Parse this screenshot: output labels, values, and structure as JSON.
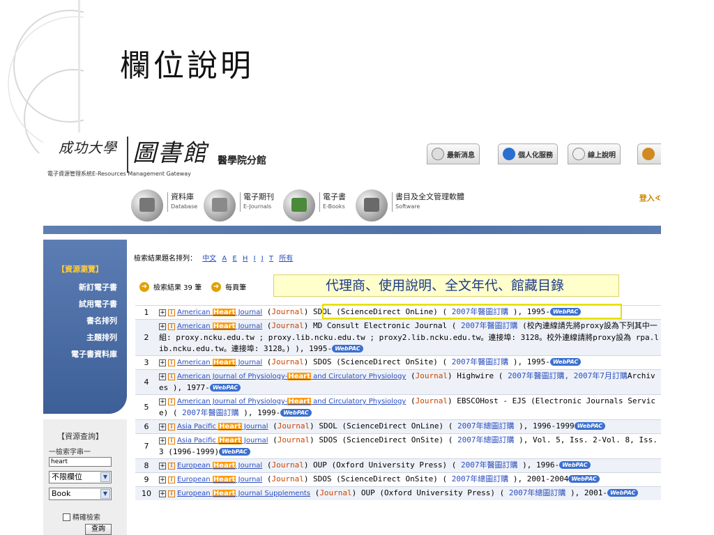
{
  "slide": {
    "title": "欄位說明",
    "callout": "代理商、使用說明、全文年代、館藏目錄"
  },
  "header": {
    "logo_university": "成功大學",
    "logo_subtitle": "電子資源管理系統E-Resources Management Gateway",
    "logo_library": "圖書館",
    "logo_branch": "醫學院分館",
    "logo_english": "E-Resources Management Gateway",
    "top_buttons": [
      "最新消息",
      "個人化服務",
      "線上說明"
    ],
    "categories": [
      {
        "label": "資料庫",
        "sub": "Database"
      },
      {
        "label": "電子期刊",
        "sub": "E-Journals"
      },
      {
        "label": "電子書",
        "sub": "E-Books"
      },
      {
        "label": "書目及全文管理軟體",
        "sub": "Software"
      }
    ],
    "login": "登入∢"
  },
  "sidebar": {
    "header": "【資源瀏覽】",
    "items": [
      "新訂電子書",
      "試用電子書",
      "書名排列",
      "主題排列",
      "電子書資料庫"
    ]
  },
  "search": {
    "title": "【資源查詢】",
    "subtitle": "一檢索字串一",
    "query": "heart",
    "field": "不限欄位",
    "type": "Book",
    "exact_label": "精確檢索",
    "button": "查詢"
  },
  "main": {
    "sort_label": "檢索結果題名排列：",
    "sort_links": [
      "中文",
      "A",
      "E",
      "H",
      "I",
      "J",
      "T",
      "所有"
    ],
    "results_count": "檢索結果 39 筆",
    "per_page": "每頁筆"
  },
  "results": [
    {
      "num": "1",
      "pre": "American ",
      "hl": "Heart",
      "post": " Journal",
      "tail": " SDOL (ScienceDirect OnLine) ( ",
      "order": "2007年醫圖訂購",
      "end": " ), 1995-"
    },
    {
      "num": "2",
      "pre": "American ",
      "hl": "Heart",
      "post": " Journal",
      "tail": " MD Consult Electronic Journal ( ",
      "order": "2007年醫圖訂購",
      "end": " (校內連線請先將proxy設為下列其中一組: proxy.ncku.edu.tw ; proxy.lib.ncku.edu.tw ; proxy2.lib.ncku.edu.tw。連接埠: 3128。校外連線請將proxy設為 rpa.lib.ncku.edu.tw。連接埠: 3128。) ), 1995-"
    },
    {
      "num": "3",
      "pre": "American ",
      "hl": "Heart",
      "post": " Journal",
      "tail": " SDOS (ScienceDirect OnSite) ( ",
      "order": "2007年醫圖訂購",
      "end": " ), 1995-"
    },
    {
      "num": "4",
      "pre": "American Journal of Physiology-",
      "hl": "Heart",
      "post": " and Circulatory Physiology",
      "tail": " Highwire ( ",
      "order": "2007年醫圖訂購, 2007年7月訂購",
      "end": "Archives ), 1977-"
    },
    {
      "num": "5",
      "pre": "American Journal of Physiology-",
      "hl": "Heart",
      "post": " and Circulatory Physiology",
      "tail": " EBSCOHost - EJS (Electronic Journals Service) ( ",
      "order": "2007年醫圖訂購",
      "end": " ), 1999-"
    },
    {
      "num": "6",
      "pre": "Asia Pacific ",
      "hl": "Heart",
      "post": " Journal",
      "tail": " SDOL (ScienceDirect OnLine) ( ",
      "order": "2007年總圖訂購",
      "end": " ), 1996-1999"
    },
    {
      "num": "7",
      "pre": "Asia Pacific ",
      "hl": "Heart",
      "post": " Journal",
      "tail": " SDOS (ScienceDirect OnSite) ( ",
      "order": "2007年總圖訂購",
      "end": " ), Vol. 5, Iss. 2-Vol. 8, Iss. 3 (1996-1999)"
    },
    {
      "num": "8",
      "pre": "European ",
      "hl": "Heart",
      "post": " Journal",
      "tail": " OUP (Oxford University Press) ( ",
      "order": "2007年醫圖訂購",
      "end": " ), 1996-"
    },
    {
      "num": "9",
      "pre": "European ",
      "hl": "Heart",
      "post": " Journal",
      "tail": " SDOS (ScienceDirect OnSite) ( ",
      "order": "2007年總圖訂購",
      "end": " ), 2001-2004"
    },
    {
      "num": "10",
      "pre": "European ",
      "hl": "Heart",
      "post": " Journal Supplements",
      "tail": " OUP (Oxford University Press) ( ",
      "order": "2007年總圖訂購",
      "end": " ), 2001-"
    }
  ],
  "journal_tag": "Journal",
  "webpac": "WebPAC"
}
